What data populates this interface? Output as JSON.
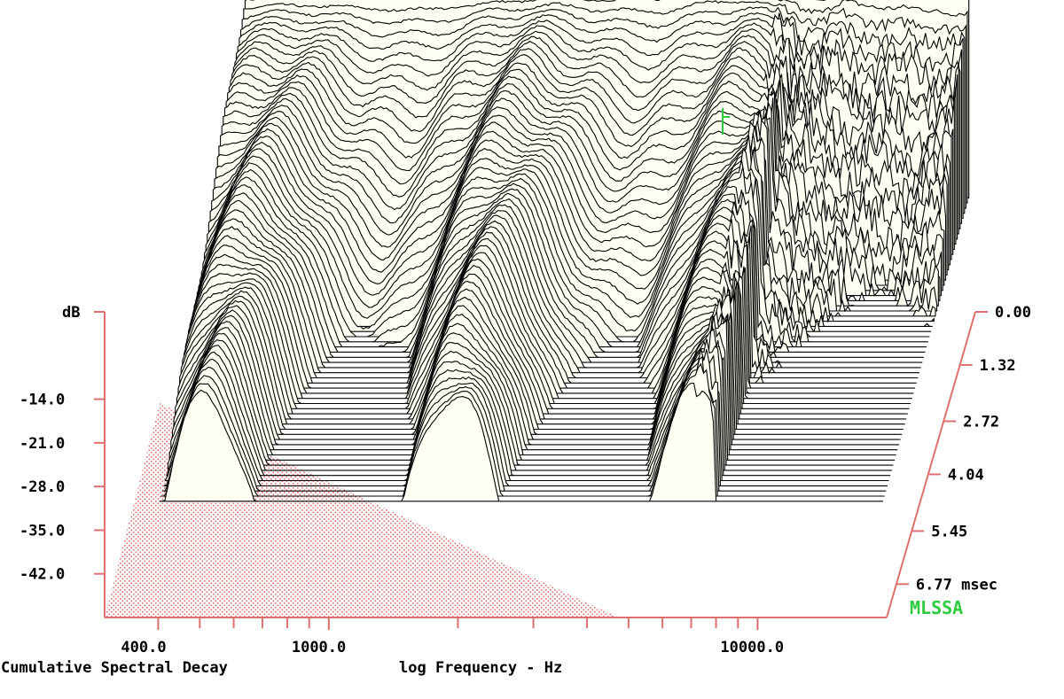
{
  "chart_data": {
    "type": "waterfall",
    "title": "Cumulative Spectral Decay",
    "xlabel": "log Frequency - Hz",
    "ylabel": "dB",
    "zlabel": "msec",
    "x_scale": "log",
    "xlim": [
      300,
      20000
    ],
    "x_tick_labels": [
      "400.0",
      "1000.0",
      "10000.0"
    ],
    "x_tick_values": [
      400,
      1000,
      10000
    ],
    "x_minor_ticks": [
      500,
      600,
      700,
      800,
      900,
      2000,
      3000,
      4000,
      5000,
      6000,
      7000,
      8000,
      9000
    ],
    "ylim": [
      -49,
      0
    ],
    "y_tick_labels": [
      "-14.0",
      "-21.0",
      "-28.0",
      "-35.0",
      "-42.0"
    ],
    "y_tick_values": [
      -14,
      -21,
      -28,
      -35,
      -42
    ],
    "z_tick_labels": [
      "0.00",
      "1.32",
      "2.72",
      "4.04",
      "5.45",
      "6.77"
    ],
    "z_tick_values": [
      0,
      1.32,
      2.72,
      4.04,
      5.45,
      6.77
    ],
    "z_unit": "msec",
    "zlim": [
      0,
      7.6
    ],
    "num_slices": 60,
    "initial_response_db": [
      {
        "f": 400,
        "db": 1.2
      },
      {
        "f": 500,
        "db": 1.4
      },
      {
        "f": 700,
        "db": 1.6
      },
      {
        "f": 1000,
        "db": 1.8
      },
      {
        "f": 1500,
        "db": 2.4
      },
      {
        "f": 2000,
        "db": 2.9
      },
      {
        "f": 2500,
        "db": 3.6
      },
      {
        "f": 3000,
        "db": 3.9
      },
      {
        "f": 4000,
        "db": 4.8
      },
      {
        "f": 5000,
        "db": 5.6
      },
      {
        "f": 6000,
        "db": 5.0
      },
      {
        "f": 7000,
        "db": 2.5
      },
      {
        "f": 8000,
        "db": 1.5
      },
      {
        "f": 9000,
        "db": 1.0
      },
      {
        "f": 10000,
        "db": 3.8
      },
      {
        "f": 12000,
        "db": 3.2
      },
      {
        "f": 14000,
        "db": 3.0
      },
      {
        "f": 17000,
        "db": 1.8
      },
      {
        "f": 19000,
        "db": 1.2
      }
    ],
    "brand": "MLSSA"
  },
  "colors": {
    "axis": "#e07070",
    "floor_hatch": "#e07070",
    "traces": "#000000",
    "fill": "#fffff4",
    "brand": "#2ecc40",
    "cursor": "#2ecc40"
  }
}
